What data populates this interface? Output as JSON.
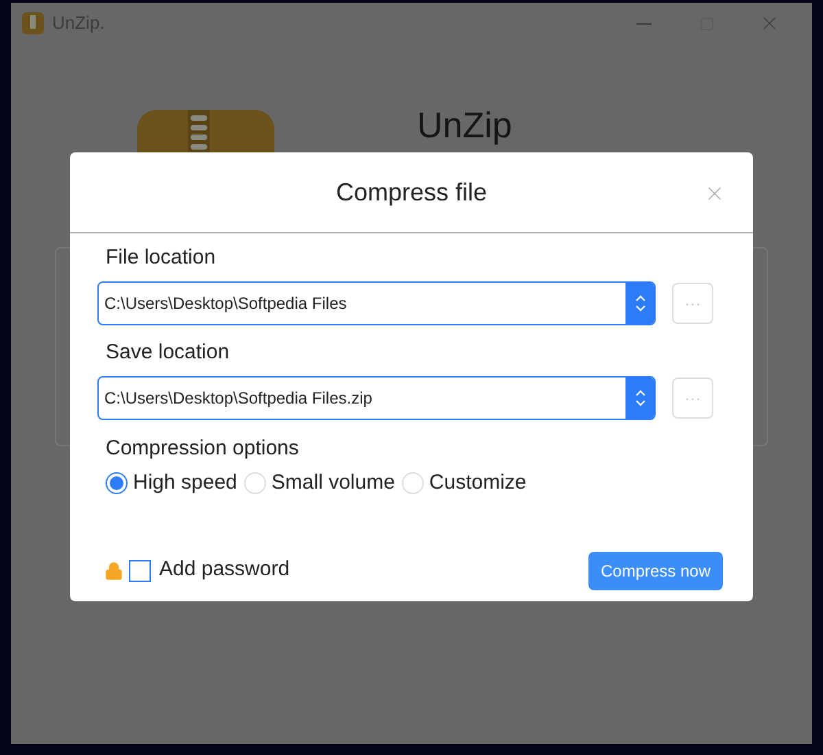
{
  "window": {
    "title": "UnZip.",
    "app_heading": "UnZip"
  },
  "dialog": {
    "title": "Compress file",
    "fields": [
      {
        "label": "File location",
        "value": "C:\\Users\\Desktop\\Softpedia Files",
        "browse": "···"
      },
      {
        "label": "Save location",
        "value": "C:\\Users\\Desktop\\Softpedia Files.zip",
        "browse": "···"
      }
    ],
    "options_label": "Compression options",
    "options": [
      {
        "label": "High speed",
        "selected": true
      },
      {
        "label": "Small volume",
        "selected": false
      },
      {
        "label": "Customize",
        "selected": false
      }
    ],
    "password": {
      "label": "Add password",
      "checked": false
    },
    "button": "Compress now"
  }
}
